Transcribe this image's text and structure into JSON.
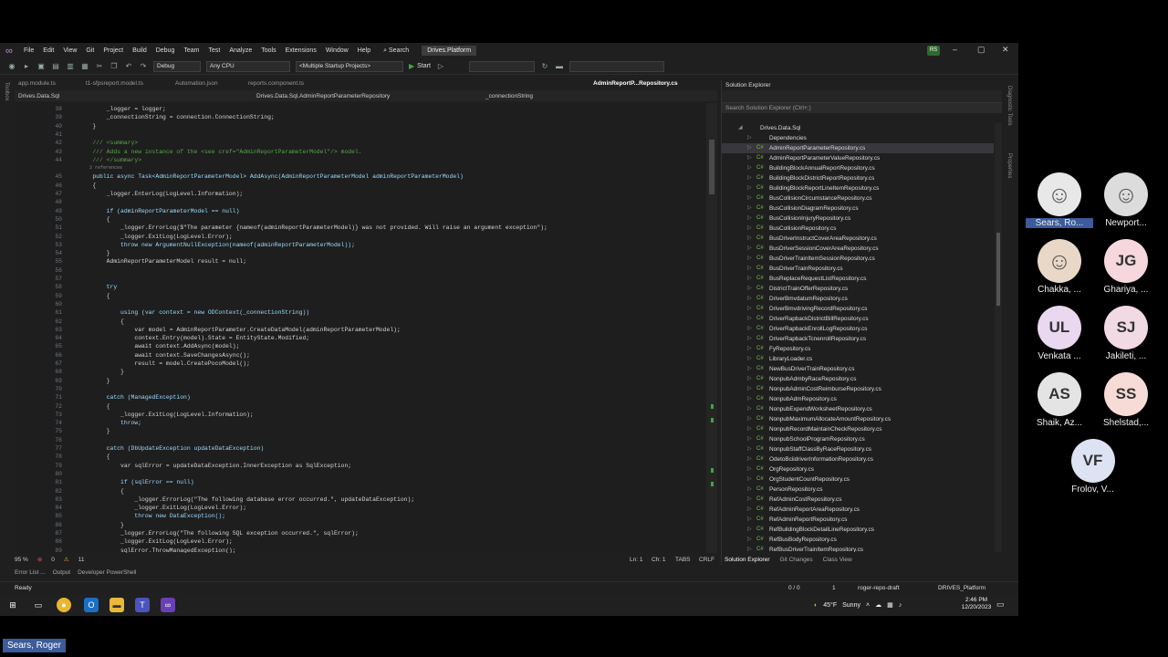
{
  "app": {
    "menus": [
      "File",
      "Edit",
      "View",
      "Git",
      "Project",
      "Build",
      "Debug",
      "Team",
      "Test",
      "Analyze",
      "Tools",
      "Extensions",
      "Window",
      "Help"
    ],
    "search_label": "Search",
    "solution_name": "Drives.Platform",
    "user_initials": "RS"
  },
  "toolbar": {
    "config": "Debug",
    "platform": "Any CPU",
    "startup": "<Multiple Startup Projects>",
    "start_label": "Start"
  },
  "tabs": [
    {
      "label": "app.module.ts",
      "active": false
    },
    {
      "label": "t1-sfpsreport.model.ts",
      "active": false
    },
    {
      "label": "Automation.json",
      "active": false
    },
    {
      "label": "reports.component.ts",
      "active": false
    },
    {
      "label": "AdminReportP...Repository.cs",
      "active": true
    }
  ],
  "navbar": {
    "project": "Drives.Data.Sql",
    "class": "Drives.Data.Sql.AdminReportParameterRepository",
    "member": "_connectionString"
  },
  "editor": {
    "lines": [
      {
        "n": "38",
        "t": "        _logger = logger;"
      },
      {
        "n": "39",
        "t": "        _connectionString = connection.ConnectionString;"
      },
      {
        "n": "40",
        "t": "    }"
      },
      {
        "n": "41",
        "t": ""
      },
      {
        "n": "42",
        "t": "    /// <summary>"
      },
      {
        "n": "43",
        "t": "    /// Adds a new instance of the <see cref=\"AdminReportParameterModel\"/> model."
      },
      {
        "n": "44",
        "t": "    /// </summary>"
      },
      {
        "n": "",
        "t": "    2 references"
      },
      {
        "n": "45",
        "t": "    public async Task<AdminReportParameterModel> AddAsync(AdminReportParameterModel adminReportParameterModel)"
      },
      {
        "n": "46",
        "t": "    {"
      },
      {
        "n": "47",
        "t": "        _logger.EnterLog(LogLevel.Information);"
      },
      {
        "n": "48",
        "t": ""
      },
      {
        "n": "49",
        "t": "        if (adminReportParameterModel == null)"
      },
      {
        "n": "50",
        "t": "        {"
      },
      {
        "n": "51",
        "t": "            _logger.ErrorLog($\"The parameter {nameof(adminReportParameterModel)} was not provided. Will raise an argument exception\");"
      },
      {
        "n": "52",
        "t": "            _logger.ExitLog(LogLevel.Error);"
      },
      {
        "n": "53",
        "t": "            throw new ArgumentNullException(nameof(adminReportParameterModel));"
      },
      {
        "n": "54",
        "t": "        }"
      },
      {
        "n": "55",
        "t": "        AdminReportParameterModel result = null;"
      },
      {
        "n": "56",
        "t": ""
      },
      {
        "n": "57",
        "t": ""
      },
      {
        "n": "58",
        "t": "        try"
      },
      {
        "n": "59",
        "t": "        {"
      },
      {
        "n": "60",
        "t": ""
      },
      {
        "n": "61",
        "t": "            using (var context = new ODContext(_connectionString))"
      },
      {
        "n": "62",
        "t": "            {"
      },
      {
        "n": "63",
        "t": "                var model = AdminReportParameter.CreateDataModel(adminReportParameterModel);"
      },
      {
        "n": "64",
        "t": "                context.Entry(model).State = EntityState.Modified;"
      },
      {
        "n": "65",
        "t": "                await context.AddAsync(model);"
      },
      {
        "n": "66",
        "t": "                await context.SaveChangesAsync();"
      },
      {
        "n": "67",
        "t": "                result = model.CreatePocoModel();"
      },
      {
        "n": "68",
        "t": "            }"
      },
      {
        "n": "69",
        "t": "        }"
      },
      {
        "n": "70",
        "t": ""
      },
      {
        "n": "71",
        "t": "        catch (ManagedException)"
      },
      {
        "n": "72",
        "t": "        {"
      },
      {
        "n": "73",
        "t": "            _logger.ExitLog(LogLevel.Information);"
      },
      {
        "n": "74",
        "t": "            throw;"
      },
      {
        "n": "75",
        "t": "        }"
      },
      {
        "n": "76",
        "t": ""
      },
      {
        "n": "77",
        "t": "        catch (DbUpdateException updateDataException)"
      },
      {
        "n": "78",
        "t": "        {"
      },
      {
        "n": "79",
        "t": "            var sqlError = updateDataException.InnerException as SqlException;"
      },
      {
        "n": "80",
        "t": ""
      },
      {
        "n": "81",
        "t": "            if (sqlError == null)"
      },
      {
        "n": "82",
        "t": "            {"
      },
      {
        "n": "83",
        "t": "                _logger.ErrorLog(\"The following database error occurred.\", updateDataException);"
      },
      {
        "n": "84",
        "t": "                _logger.ExitLog(LogLevel.Error);"
      },
      {
        "n": "85",
        "t": "                throw new DataException();"
      },
      {
        "n": "86",
        "t": "            }"
      },
      {
        "n": "87",
        "t": "            _logger.ErrorLog(\"The following SQL exception occurred.\", sqlError);"
      },
      {
        "n": "88",
        "t": "            _logger.ExitLog(LogLevel.Error);"
      },
      {
        "n": "89",
        "t": "            sqlError.ThrowManagedException();"
      }
    ]
  },
  "editor_status": {
    "zoom": "95 %",
    "errors": "0",
    "warnings": "11",
    "ln": "Ln: 1",
    "ch": "Ch: 1",
    "tabs": "TABS",
    "eol": "CRLF"
  },
  "bottom_tabs": [
    "Error List ...",
    "Output",
    "Developer PowerShell"
  ],
  "status": {
    "ready": "Ready",
    "changes": "0 / 0",
    "pending": "1",
    "branch": "roger-repo-draft",
    "repo": "DRIVES_Platform"
  },
  "solution_explorer": {
    "title": "Solution Explorer",
    "search_placeholder": "Search Solution Explorer (Ctrl+;)",
    "project": "Drives.Data.Sql",
    "dependencies": "Dependencies",
    "files": [
      "AdminReportParameterRepository.cs",
      "AdminReportParameterValueRepository.cs",
      "BuildingBlockAnnualReportRepository.cs",
      "BuildingBlockDistrictReportRepository.cs",
      "BuildingBlockReportLineItemRepository.cs",
      "BusCollisionCircumstanceRepository.cs",
      "BusCollisionDiagramRepository.cs",
      "BusCollisionInjuryRepository.cs",
      "BusCollisionRepository.cs",
      "BusDriverInstructCoverAreaRepository.cs",
      "BusDriverSessionCoverAreaRepository.cs",
      "BusDriverTrainItemSessionRepository.cs",
      "BusDriverTrainRepository.cs",
      "BusReplaceRequestListRepository.cs",
      "DistrictTrainOfferRepository.cs",
      "DriverBmvdatumRepository.cs",
      "DriverBmvdrivingRecordRepository.cs",
      "DriverRapbackDistrictBillRepository.cs",
      "DriverRapbackEnrollLogRepository.cs",
      "DriverRapbackTcnenrollRepository.cs",
      "FyRepository.cs",
      "LibraryLoader.cs",
      "NewBusDriverTrainRepository.cs",
      "NonpubAdmbyRaceRepository.cs",
      "NonpubAdminCostReimburseRepository.cs",
      "NonpubAdmRepository.cs",
      "NonpubExpendWorksheetRepository.cs",
      "NonpubMaximumAllocateAmountRepository.cs",
      "NonpubRecordMaintainCheckRepository.cs",
      "NonpubSchoolProgramRepository.cs",
      "NonpubStaffClassByRaceRepository.cs",
      "OdetoBciidriverInformationRepository.cs",
      "OrgRepository.cs",
      "OrgStudentCountRepository.cs",
      "PersonRepository.cs",
      "RefAdminCostRepository.cs",
      "RefAdminReportAreaRepository.cs",
      "RefAdminReportRepository.cs",
      "RefBuildingBlockDetailLineRepository.cs",
      "RefBusBodyRepository.cs",
      "RefBusDriverTrainItemRepository.cs"
    ],
    "bottom_tabs": [
      "Solution Explorer",
      "Git Changes",
      "Class View"
    ]
  },
  "side_labels": {
    "left": "Toolbox",
    "right1": "Diagnostic Tools",
    "right2": "Properties"
  },
  "taskbar": {
    "weather_temp": "45°F",
    "weather_desc": "Sunny",
    "time": "2:46 PM",
    "date": "12/20/2023"
  },
  "participants": [
    {
      "initials": "",
      "name": "Sears, Ro...",
      "color": "#e8e8e8",
      "photo": true,
      "highlight": true
    },
    {
      "initials": "",
      "name": "Newport...",
      "color": "#dcdcdc",
      "photo": true,
      "highlight": false
    },
    {
      "initials": "",
      "name": "Chakka, ...",
      "color": "#e9d8c8",
      "photo": true,
      "highlight": false
    },
    {
      "initials": "JG",
      "name": "Ghariya, ...",
      "color": "#f6d7de",
      "photo": false,
      "highlight": false
    },
    {
      "initials": "UL",
      "name": "Venkata ...",
      "color": "#ead7f0",
      "photo": false,
      "highlight": false
    },
    {
      "initials": "SJ",
      "name": "Jakileti, ...",
      "color": "#f2dae4",
      "photo": false,
      "highlight": false
    },
    {
      "initials": "AS",
      "name": "Shaik, Az...",
      "color": "#e4e4e4",
      "photo": false,
      "highlight": false
    },
    {
      "initials": "SS",
      "name": "Shelstad,...",
      "color": "#f6dbd6",
      "photo": false,
      "highlight": false
    },
    {
      "initials": "VF",
      "name": "Frolov, V...",
      "color": "#dde3f3",
      "photo": false,
      "highlight": false
    }
  ],
  "active_speaker": "Sears, Roger"
}
